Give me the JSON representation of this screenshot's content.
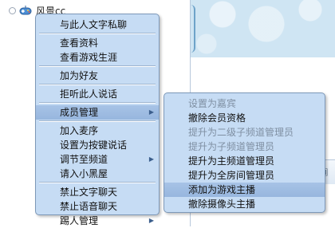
{
  "user": {
    "name": "风景cc"
  },
  "main_menu": {
    "groups": [
      [
        "与此人文字私聊"
      ],
      [
        "查看资料",
        "查看游戏生涯"
      ],
      [
        "加为好友"
      ],
      [
        "拒听此人说话"
      ],
      [
        "成员管理"
      ],
      [
        "加入麦序",
        "设置为按键说话",
        "调节至频道",
        "请入小黑屋"
      ],
      [
        "禁止文字聊天",
        "禁止语音聊天",
        "踢人管理"
      ]
    ],
    "arrow_items": [
      "成员管理",
      "调节至频道",
      "踢人管理"
    ],
    "highlighted": "成员管理"
  },
  "sub_menu": {
    "items": [
      {
        "label": "设置为嘉宾",
        "enabled": false
      },
      {
        "label": "撤除会员资格",
        "enabled": true
      },
      {
        "label": "提升为二级子频道管理员",
        "enabled": false
      },
      {
        "label": "提升为子频道管理员",
        "enabled": false
      },
      {
        "label": "提升为主频道管理员",
        "enabled": true
      },
      {
        "label": "提升为全房间管理员",
        "enabled": true
      },
      {
        "label": "添加为游戏主播",
        "enabled": true
      },
      {
        "label": "撤除摄像头主播",
        "enabled": true
      }
    ],
    "highlighted": "添加为游戏主播"
  },
  "icons": {
    "user_status": "radio-icon",
    "user_avatar": "game-controller-icon",
    "submenu_arrow": "triangle-right-icon"
  },
  "colors": {
    "menu_bg": "#c6dcf4",
    "menu_border": "#7d98b8",
    "highlight_bg": "#a7c3e6",
    "disabled_text": "#7f8fa2"
  }
}
